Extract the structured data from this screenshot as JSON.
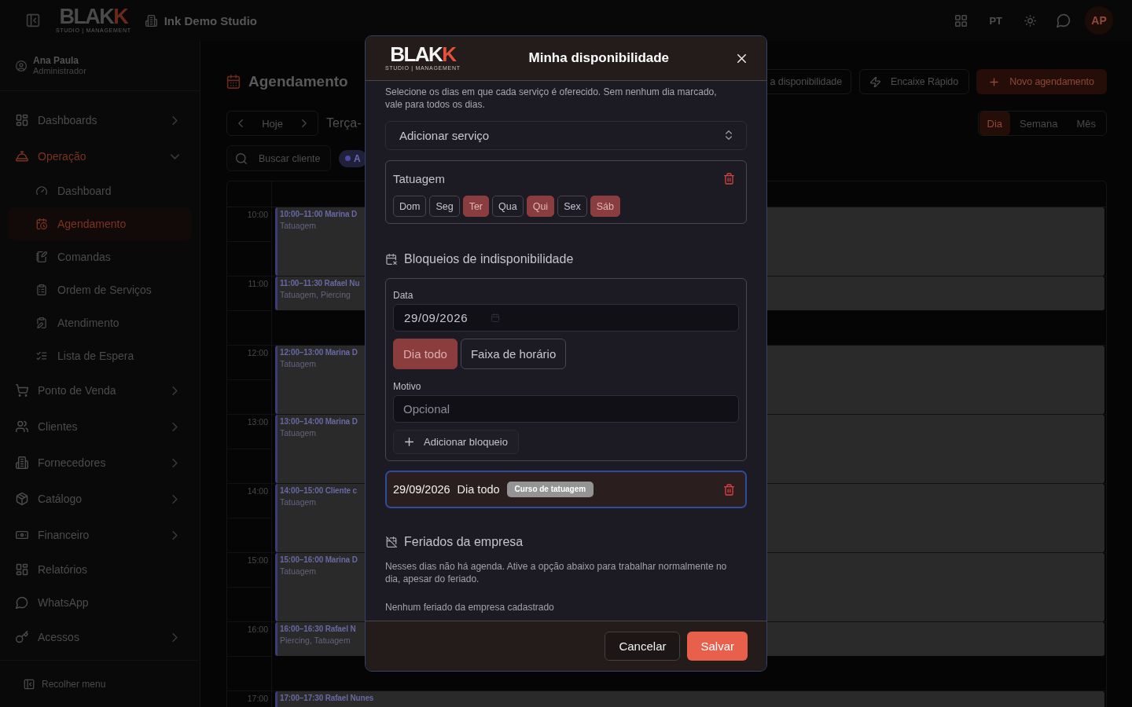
{
  "topbar": {
    "logo": {
      "text": "BLAK",
      "accent": "K",
      "tagline": "STUDIO | MANAGEMENT"
    },
    "studio_name": "Ink Demo Studio",
    "language": "PT",
    "avatar_initials": "AP"
  },
  "sidebar": {
    "user": {
      "name": "Ana Paula",
      "role": "Administrador"
    },
    "items": [
      {
        "kind": "group",
        "label": "Dashboards",
        "active": false,
        "expanded": false
      },
      {
        "kind": "group",
        "label": "Operação",
        "active": true,
        "expanded": true,
        "children": [
          {
            "label": "Dashboard",
            "selected": false
          },
          {
            "label": "Agendamento",
            "selected": true
          },
          {
            "label": "Comandas",
            "selected": false
          },
          {
            "label": "Ordem de Serviços",
            "selected": false
          },
          {
            "label": "Atendimento",
            "selected": false
          },
          {
            "label": "Lista de Espera",
            "selected": false
          }
        ]
      },
      {
        "kind": "group",
        "label": "Ponto de Venda",
        "active": false,
        "expanded": false
      },
      {
        "kind": "group",
        "label": "Clientes",
        "active": false,
        "expanded": false
      },
      {
        "kind": "group",
        "label": "Fornecedores",
        "active": false,
        "expanded": false
      },
      {
        "kind": "group",
        "label": "Catálogo",
        "active": false,
        "expanded": false
      },
      {
        "kind": "group",
        "label": "Financeiro",
        "active": false,
        "expanded": false
      },
      {
        "kind": "link",
        "label": "Relatórios",
        "active": false
      },
      {
        "kind": "link",
        "label": "WhatsApp",
        "active": false
      },
      {
        "kind": "group",
        "label": "Acessos",
        "active": false,
        "expanded": false
      }
    ],
    "collapse_label": "Recolher menu"
  },
  "page": {
    "title": "Agendamento",
    "actions": [
      {
        "kind": "outline",
        "label": "a disponibilidade"
      },
      {
        "kind": "outline",
        "label": "Encaixe Rápido"
      },
      {
        "kind": "primary",
        "label": "Novo agendamento"
      }
    ],
    "date_nav": {
      "today_label": "Hoje",
      "date_label": "Terça-"
    },
    "view_tabs": [
      {
        "label": "Dia",
        "selected": true
      },
      {
        "label": "Semana",
        "selected": false
      },
      {
        "label": "Mês",
        "selected": false
      }
    ],
    "search": {
      "placeholder": "Buscar cliente"
    },
    "filter_chip": {
      "label": "A"
    },
    "calendar": {
      "slots": [
        {
          "time": "10:00",
          "event": {
            "kind": "hour",
            "title": "10:00–11:00 Marina D",
            "services": "Tatuagem"
          }
        },
        {
          "time": "11:00",
          "event": {
            "kind": "half",
            "title": "11:00–11:30 Rafael Nu",
            "services": "Tatuagem, Piercing"
          }
        },
        {
          "time": "12:00",
          "event": {
            "kind": "hour",
            "title": "12:00–13:00 Marina D",
            "services": "Tatuagem"
          }
        },
        {
          "time": "13:00",
          "event": {
            "kind": "hour",
            "title": "13:00–14:00 Marina D",
            "services": "Tatuagem"
          }
        },
        {
          "time": "14:00",
          "event": {
            "kind": "hour",
            "title": "14:00–15:00 Cliente c",
            "services": "Tatuagem"
          }
        },
        {
          "time": "15:00",
          "event": {
            "kind": "hour",
            "title": "15:00–16:00 Marina D",
            "services": "Tatuagem"
          }
        },
        {
          "time": "16:00",
          "event": {
            "kind": "half",
            "title": "16:00–16:30 Rafael N",
            "services": "Piercing, Tatuagem"
          }
        },
        {
          "time": "17:00",
          "event": {
            "kind": "half",
            "title": "17:00–17:30 Rafael Nunes"
          }
        }
      ]
    }
  },
  "modal": {
    "logo": {
      "text": "BLAK",
      "accent": "K",
      "tagline": "STUDIO | MANAGEMENT"
    },
    "title": "Minha disponibilidade",
    "intro": "Selecione os dias em que cada serviço é oferecido. Sem nenhum dia marcado, vale para todos os dias.",
    "service_select": {
      "placeholder": "Adicionar serviço"
    },
    "services": [
      {
        "name": "Tatuagem",
        "days": [
          {
            "label": "Dom",
            "selected": false
          },
          {
            "label": "Seg",
            "selected": false
          },
          {
            "label": "Ter",
            "selected": true
          },
          {
            "label": "Qua",
            "selected": false
          },
          {
            "label": "Qui",
            "selected": true
          },
          {
            "label": "Sex",
            "selected": false
          },
          {
            "label": "Sáb",
            "selected": true
          }
        ]
      }
    ],
    "blocks_section": {
      "title": "Bloqueios de indisponibilidade",
      "date_label": "Data",
      "date_value": "29/09/2026",
      "modes": [
        {
          "label": "Dia todo",
          "selected": true
        },
        {
          "label": "Faixa de horário",
          "selected": false
        }
      ],
      "reason_label": "Motivo",
      "reason_placeholder": "Opcional",
      "add_label": "Adicionar bloqueio",
      "blocks": [
        {
          "date": "29/09/2026",
          "period": "Dia todo",
          "reason": "Curso de tatuagem",
          "focused": true
        }
      ]
    },
    "holidays_section": {
      "title": "Feriados da empresa",
      "description": "Nesses dias não há agenda. Ative a opção abaixo para trabalhar normalmente no dia, apesar do feriado.",
      "empty_text": "Nenhum feriado da empresa cadastrado"
    },
    "buttons": [
      {
        "kind": "secondary",
        "label": "Cancelar"
      },
      {
        "kind": "primary",
        "label": "Salvar"
      }
    ]
  }
}
